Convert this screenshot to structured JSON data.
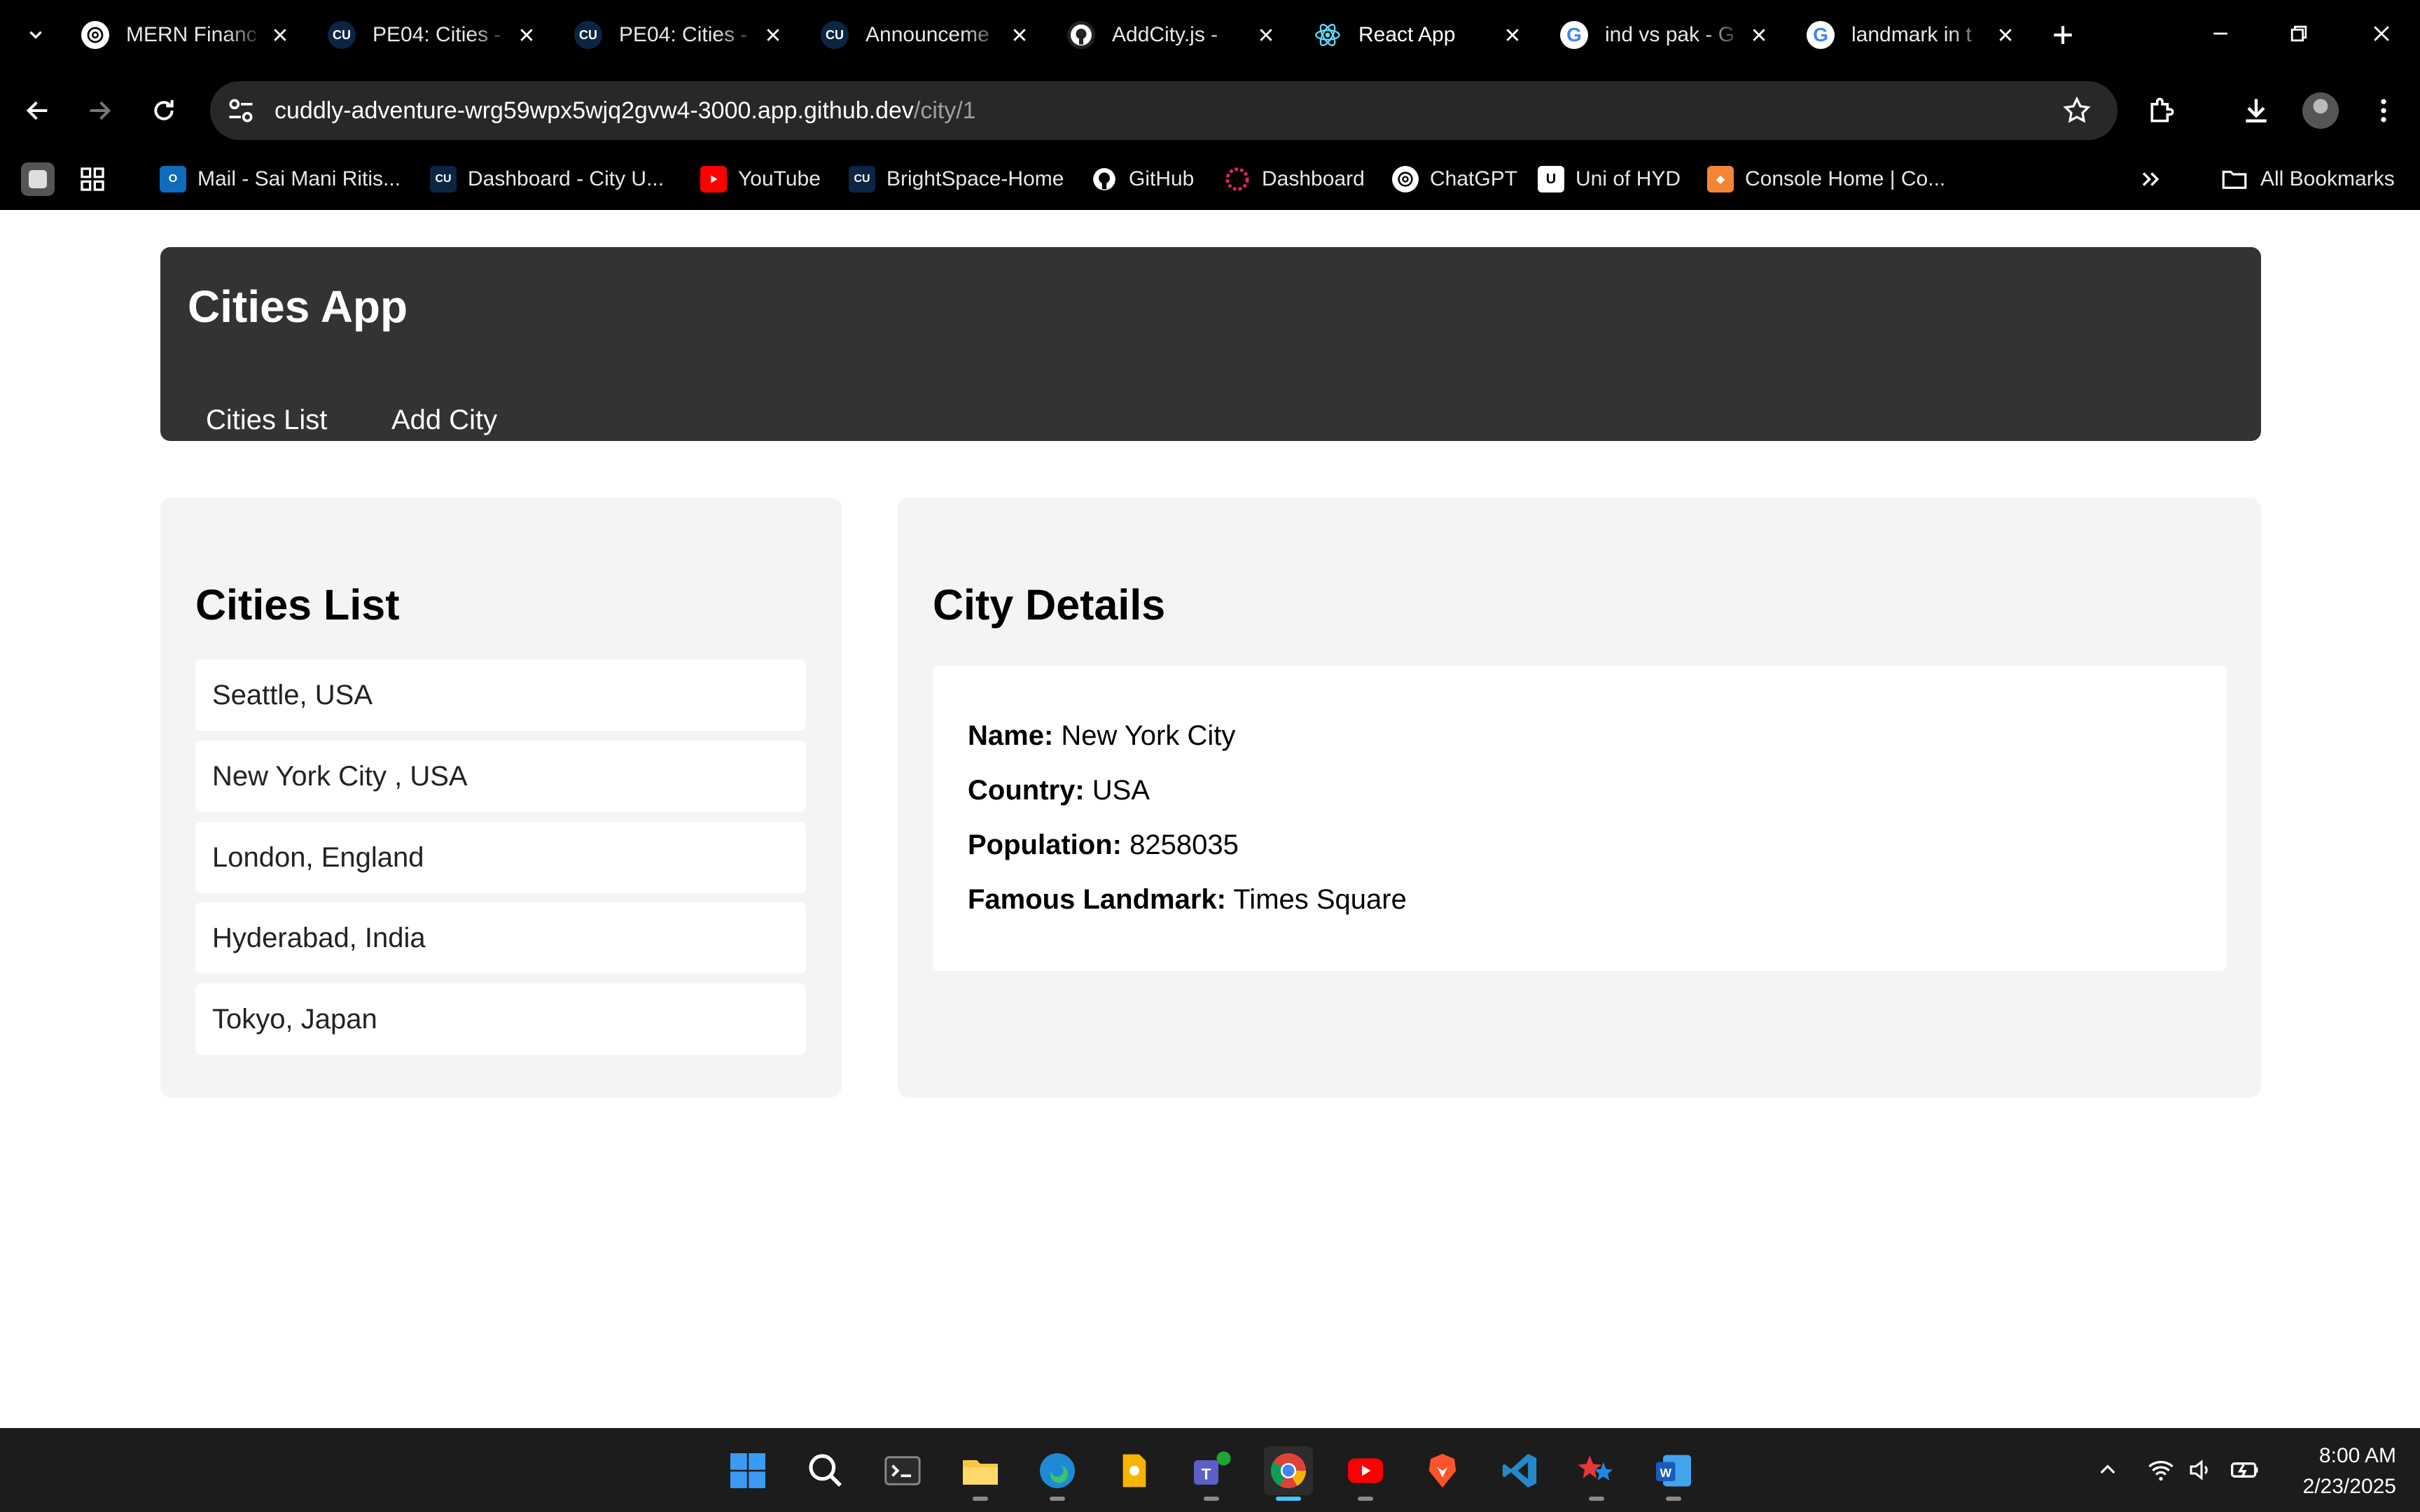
{
  "browser": {
    "tabs": [
      {
        "title": "MERN Financ",
        "icon": "chatgpt-icon"
      },
      {
        "title": "PE04: Cities -",
        "icon": "cu-icon"
      },
      {
        "title": "PE04: Cities -",
        "icon": "cu-icon"
      },
      {
        "title": "Announceme",
        "icon": "cu-icon"
      },
      {
        "title": "AddCity.js - ",
        "icon": "github-icon"
      },
      {
        "title": "React App",
        "icon": "react-icon"
      },
      {
        "title": "ind vs pak - G",
        "icon": "google-icon"
      },
      {
        "title": "landmark in t",
        "icon": "google-icon"
      }
    ],
    "address": {
      "host": "cuddly-adventure-wrg59wpx5wjq2gvw4-3000.app.github.dev",
      "path": "/city/1"
    },
    "bookmarks": [
      {
        "label": "Mail - Sai Mani Ritis...",
        "icon": "outlook-icon"
      },
      {
        "label": "Dashboard - City U...",
        "icon": "cu-icon"
      },
      {
        "label": "YouTube",
        "icon": "youtube-icon"
      },
      {
        "label": "BrightSpace-Home",
        "icon": "cu-icon"
      },
      {
        "label": "GitHub",
        "icon": "github-icon"
      },
      {
        "label": "Dashboard",
        "icon": "dashboard-icon"
      },
      {
        "label": "ChatGPT",
        "icon": "chatgpt-icon"
      },
      {
        "label": "Uni of HYD",
        "icon": "uni-icon"
      },
      {
        "label": "Console Home | Co...",
        "icon": "aws-icon"
      }
    ],
    "all_bookmarks": "All Bookmarks"
  },
  "app": {
    "title": "Cities App",
    "nav": [
      "Cities List",
      "Add City"
    ]
  },
  "cities_panel": {
    "heading": "Cities List",
    "items": [
      "Seattle, USA",
      "New York City , USA",
      "London, England",
      "Hyderabad, India",
      "Tokyo, Japan"
    ]
  },
  "details_panel": {
    "heading": "City Details",
    "name_label": "Name:",
    "name": "New York City",
    "country_label": "Country:",
    "country": "USA",
    "population_label": "Population:",
    "population": "8258035",
    "landmark_label": "Famous Landmark:",
    "landmark": "Times Square"
  },
  "taskbar": {
    "time": "8:00 AM",
    "date": "2/23/2025"
  },
  "colors": {
    "header_bg": "#333333",
    "panel_bg": "#f4f4f4",
    "browser_bg": "#000000",
    "taskbar_bg": "#1c1c1c"
  }
}
